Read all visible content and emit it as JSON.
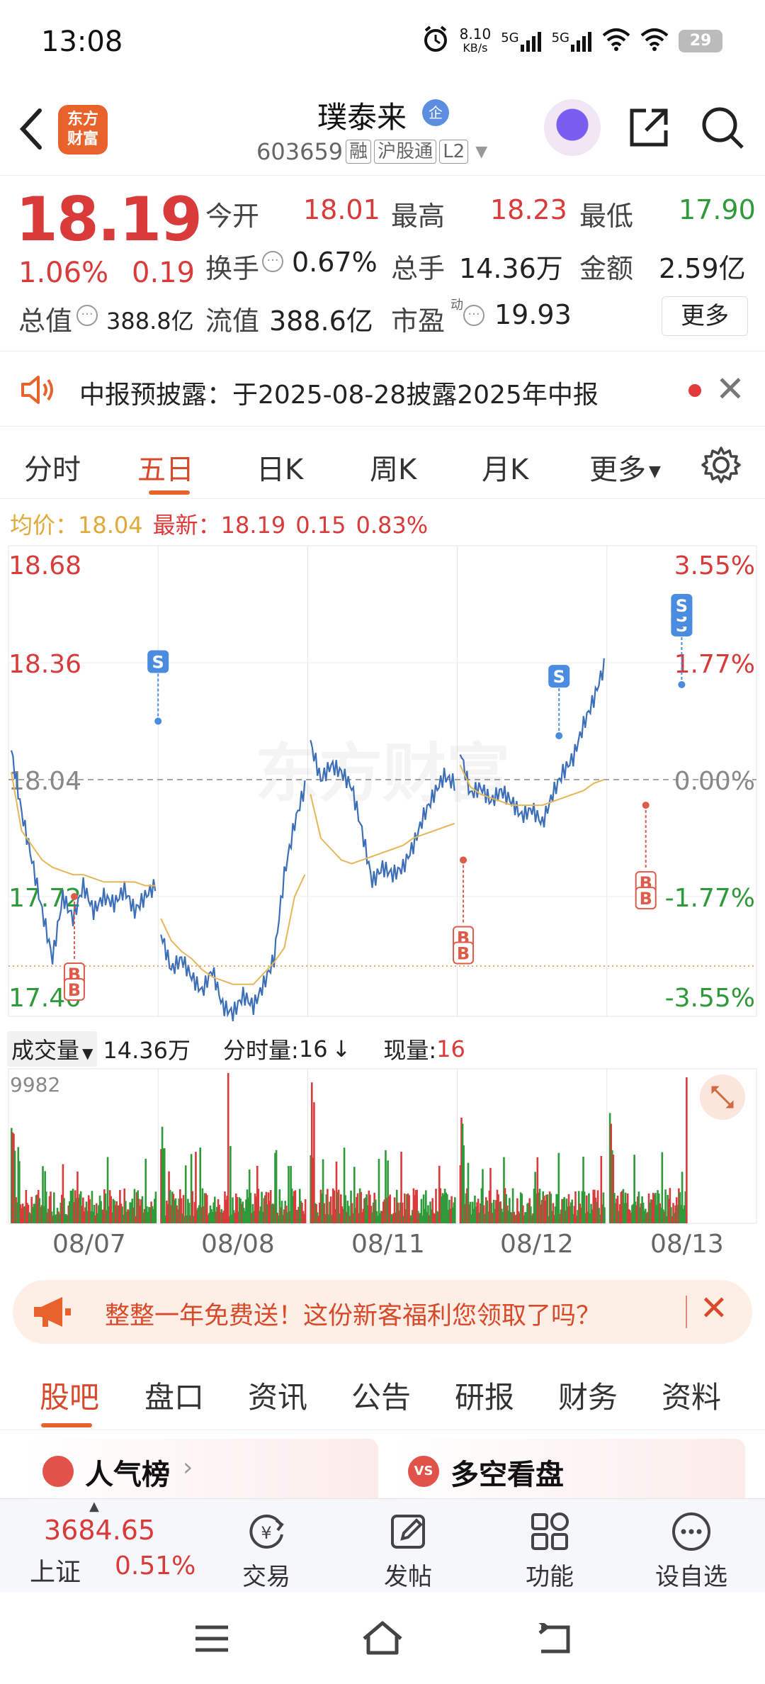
{
  "status": {
    "time": "13:08",
    "net_speed": "8.10",
    "net_unit": "KB/s",
    "sig1": "5G",
    "sig2": "5G",
    "battery": "29"
  },
  "nav": {
    "logo_line1": "东方",
    "logo_line2": "财富",
    "stock_name": "璞泰来",
    "badge": "企",
    "code": "603659",
    "tag1": "融",
    "tag2": "沪股通",
    "tag3": "L2"
  },
  "quote": {
    "price": "18.19",
    "pct": "1.06%",
    "chg": "0.19",
    "open_label": "今开",
    "open": "18.01",
    "high_label": "最高",
    "high": "18.23",
    "low_label": "最低",
    "low": "17.90",
    "turnover_label": "换手",
    "turnover": "0.67%",
    "vol_label": "总手",
    "vol": "14.36万",
    "amount_label": "金额",
    "amount": "2.59亿",
    "mcap_label": "总值",
    "mcap": "388.8亿",
    "float_label": "流值",
    "float": "388.6亿",
    "pe_label": "市盈",
    "pe_sup": "动",
    "pe": "19.93",
    "more": "更多"
  },
  "notice": {
    "text": "中报预披露：于2025-08-28披露2025年中报"
  },
  "tabs": [
    "分时",
    "五日",
    "日K",
    "周K",
    "月K",
    "更多"
  ],
  "avg_row": {
    "avg_label": "均价：",
    "avg": "18.04",
    "latest_label": "最新：",
    "latest": "18.19",
    "chg": "0.15",
    "pct": "0.83%"
  },
  "chart_data": {
    "type": "line",
    "title": "",
    "period": "五日",
    "y_labels_left": [
      "18.68",
      "18.36",
      "18.04",
      "17.72",
      "17.40"
    ],
    "y_labels_right": [
      "3.55%",
      "1.77%",
      "0.00%",
      "-1.77%",
      "-3.55%"
    ],
    "ylim": [
      17.4,
      18.68
    ],
    "prev_close": 18.04,
    "days": [
      "08/07",
      "08/08",
      "08/11",
      "08/12",
      "08/13"
    ],
    "series": [
      {
        "name": "",
        "color": "#3d6fb8",
        "values": [
          18.12,
          17.95,
          17.82,
          17.68,
          17.55,
          17.72,
          17.66,
          17.75,
          17.68,
          17.72,
          17.7,
          17.74,
          17.68,
          17.72,
          17.75,
          17.62,
          17.52,
          17.55,
          17.5,
          17.46,
          17.52,
          17.42,
          17.4,
          17.45,
          17.42,
          17.48,
          17.55,
          17.78,
          17.92,
          18.02,
          18.14,
          18.04,
          18.08,
          18.06,
          18.02,
          17.9,
          17.76,
          17.8,
          17.78,
          17.8,
          17.86,
          17.94,
          18.0,
          18.05,
          18.03,
          18.12,
          18.0,
          18.02,
          17.98,
          18.01,
          17.98,
          17.94,
          17.96,
          17.92,
          18.0,
          18.06,
          18.1,
          18.19,
          18.26,
          18.35
        ]
      },
      {
        "name": "均价",
        "color": "#e6b659",
        "values": [
          18.06,
          17.9,
          17.86,
          17.82,
          17.8,
          17.79,
          17.78,
          17.78,
          17.77,
          17.76,
          17.76,
          17.76,
          17.76,
          17.75,
          17.75,
          17.66,
          17.6,
          17.57,
          17.55,
          17.52,
          17.5,
          17.49,
          17.48,
          17.48,
          17.48,
          17.51,
          17.54,
          17.58,
          17.72,
          17.78,
          18.0,
          17.88,
          17.85,
          17.82,
          17.81,
          17.82,
          17.83,
          17.84,
          17.85,
          17.86,
          17.88,
          17.89,
          17.9,
          17.91,
          17.92,
          18.08,
          18.02,
          18.0,
          17.99,
          17.98,
          17.97,
          17.97,
          17.97,
          17.97,
          17.98,
          17.99,
          18.0,
          18.01,
          18.03,
          18.04
        ]
      }
    ],
    "trade_marks": [
      {
        "type": "B",
        "day_index": 0,
        "price": 17.72
      },
      {
        "type": "S",
        "day_index": 1,
        "price": 18.2
      },
      {
        "type": "B",
        "day_index": 3,
        "price": 17.82
      },
      {
        "type": "S",
        "day_index": 3,
        "price": 18.16
      },
      {
        "type": "B",
        "day_index": 4,
        "price": 17.97
      },
      {
        "type": "S",
        "day_index": 4,
        "price": 18.3
      }
    ]
  },
  "volume": {
    "label": "成交量",
    "total": "14.36万",
    "tick_label": "分时量:",
    "tick": "16",
    "tick_arrow": "↓",
    "now_label": "现量:",
    "now": "16",
    "max": "9982"
  },
  "promo": {
    "text": "整整一年免费送！这份新客福利您领取了吗？"
  },
  "sub_tabs": [
    "股吧",
    "盘口",
    "资讯",
    "公告",
    "研报",
    "财务",
    "资料"
  ],
  "cards": {
    "left": "人气榜",
    "right": "多空看盘"
  },
  "bottom": {
    "index_value": "3684.65",
    "index_name": "上证",
    "index_pct": "0.51%",
    "items": [
      "交易",
      "发帖",
      "功能",
      "设自选"
    ]
  }
}
